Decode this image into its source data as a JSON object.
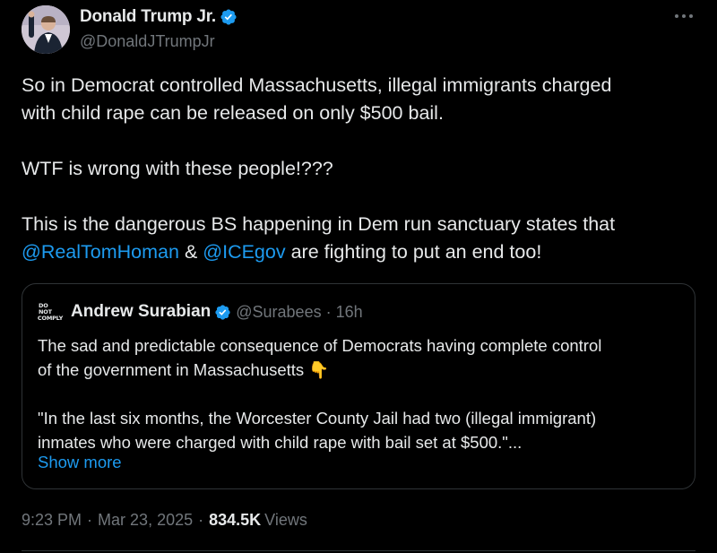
{
  "author": {
    "display_name": "Donald Trump Jr.",
    "handle": "@DonaldJTrumpJr",
    "verified": true
  },
  "more_icon": "more-horizontal-icon",
  "tweet": {
    "line1_a": "So in Democrat controlled Massachusetts, illegal immigrants charged",
    "line1_b": "with child rape can be released on only $500 bail.",
    "line2": "WTF is wrong with these people!???",
    "line3_a": "This is the dangerous BS happening in Dem run sanctuary states that",
    "mention1": "@RealTomHoman",
    "amp": " & ",
    "mention2": "@ICEgov",
    "line3_tail": " are fighting to put an end too!"
  },
  "quote": {
    "avatar_text_1": "DO NOT",
    "avatar_text_2": "COMPLY",
    "display_name": "Andrew Surabian",
    "verified": true,
    "handle_time": "@Surabees · 16h",
    "text_a": "The sad and predictable consequence of Democrats having complete control",
    "text_b": "of the government in Massachusetts 👇",
    "text_c": "\"In the last six months, the Worcester County Jail had two (illegal immigrant)",
    "text_d": "inmates who were charged with child rape with bail set at $500.\"...",
    "show_more": "Show more"
  },
  "meta": {
    "time": "9:23 PM",
    "sep1": "·",
    "date": "Mar 23, 2025",
    "sep2": "·",
    "views_count": "834.5K",
    "views_label": "Views"
  },
  "colors": {
    "background": "#000000",
    "text": "#e7e9ea",
    "secondary": "#71767b",
    "accent": "#1d9bf0",
    "border": "#2f3336"
  }
}
